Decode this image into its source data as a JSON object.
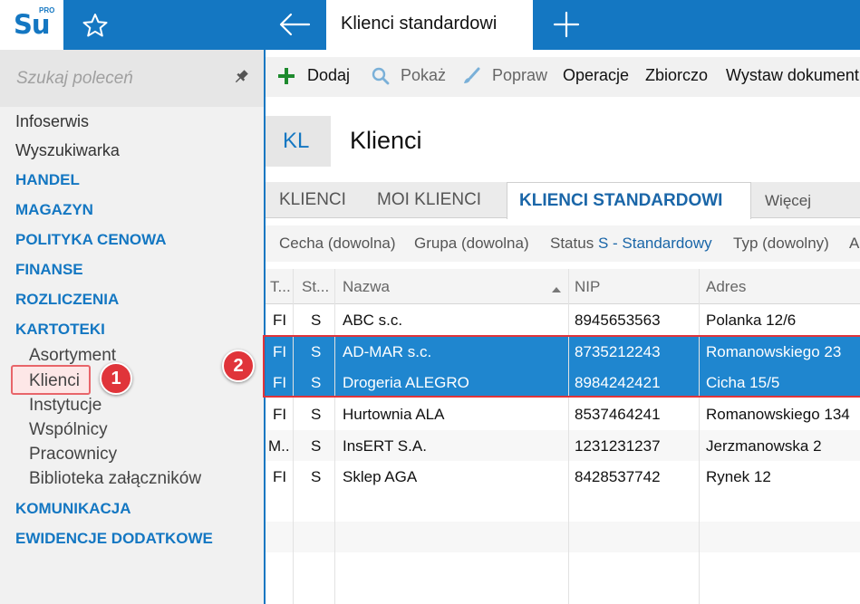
{
  "app": {
    "logo": "Su",
    "logo_sup": "PRO",
    "active_tab": "Klienci standardowi"
  },
  "sidebar": {
    "search_placeholder": "Szukaj poleceń",
    "items": [
      {
        "label": "Infoserwis"
      },
      {
        "label": "Wyszukiwarka"
      }
    ],
    "categories": {
      "handel": "HANDEL",
      "magazyn": "MAGAZYN",
      "polityka": "POLITYKA CENOWA",
      "finanse": "FINANSE",
      "rozliczenia": "ROZLICZENIA",
      "kartoteki": "KARTOTEKI",
      "komunikacja": "KOMUNIKACJA",
      "ewidencje": "EWIDENCJE DODATKOWE"
    },
    "kartoteki_items": [
      {
        "label": "Asortyment"
      },
      {
        "label": "Klienci"
      },
      {
        "label": "Instytucje"
      },
      {
        "label": "Wspólnicy"
      },
      {
        "label": "Pracownicy"
      },
      {
        "label": "Biblioteka załączników"
      }
    ]
  },
  "callouts": {
    "one": "1",
    "two": "2"
  },
  "toolbar": {
    "add": "Dodaj",
    "show": "Pokaż",
    "edit": "Popraw",
    "operations": "Operacje",
    "bulk": "Zbiorczo",
    "issue_doc": "Wystaw dokument"
  },
  "header": {
    "badge": "KL",
    "title": "Klienci"
  },
  "tabs": {
    "t1": "KLIENCI",
    "t2": "MOI KLIENCI",
    "t3": "KLIENCI STANDARDOWI",
    "more": "Więcej"
  },
  "filters": {
    "feature": "Cecha (dowolna)",
    "group": "Grupa (dowolna)",
    "status_label": "Status",
    "status_value": "S - Standardowy",
    "type": "Typ (dowolny)",
    "cut": "A"
  },
  "grid": {
    "columns": {
      "type": "T...",
      "status": "St...",
      "name": "Nazwa",
      "nip": "NIP",
      "address": "Adres"
    },
    "rows": [
      {
        "type": "FI",
        "status": "S",
        "name": "ABC s.c.",
        "nip": "8945653563",
        "address": "Polanka  12/6"
      },
      {
        "type": "FI",
        "status": "S",
        "name": "AD-MAR s.c.",
        "nip": "8735212243",
        "address": "Romanowskiego 23"
      },
      {
        "type": "FI",
        "status": "S",
        "name": "Drogeria ALEGRO",
        "nip": "8984242421",
        "address": "Cicha  15/5"
      },
      {
        "type": "FI",
        "status": "S",
        "name": "Hurtownia ALA",
        "nip": "8537464241",
        "address": "Romanowskiego 134"
      },
      {
        "type": "M..",
        "status": "S",
        "name": "InsERT S.A.",
        "nip": "1231231237",
        "address": "Jerzmanowska 2"
      },
      {
        "type": "FI",
        "status": "S",
        "name": "Sklep AGA",
        "nip": "8428537742",
        "address": "Rynek 12"
      }
    ]
  },
  "colors": {
    "brand": "#1477c2",
    "selection": "#1f86cf",
    "callout": "#e0343a"
  }
}
